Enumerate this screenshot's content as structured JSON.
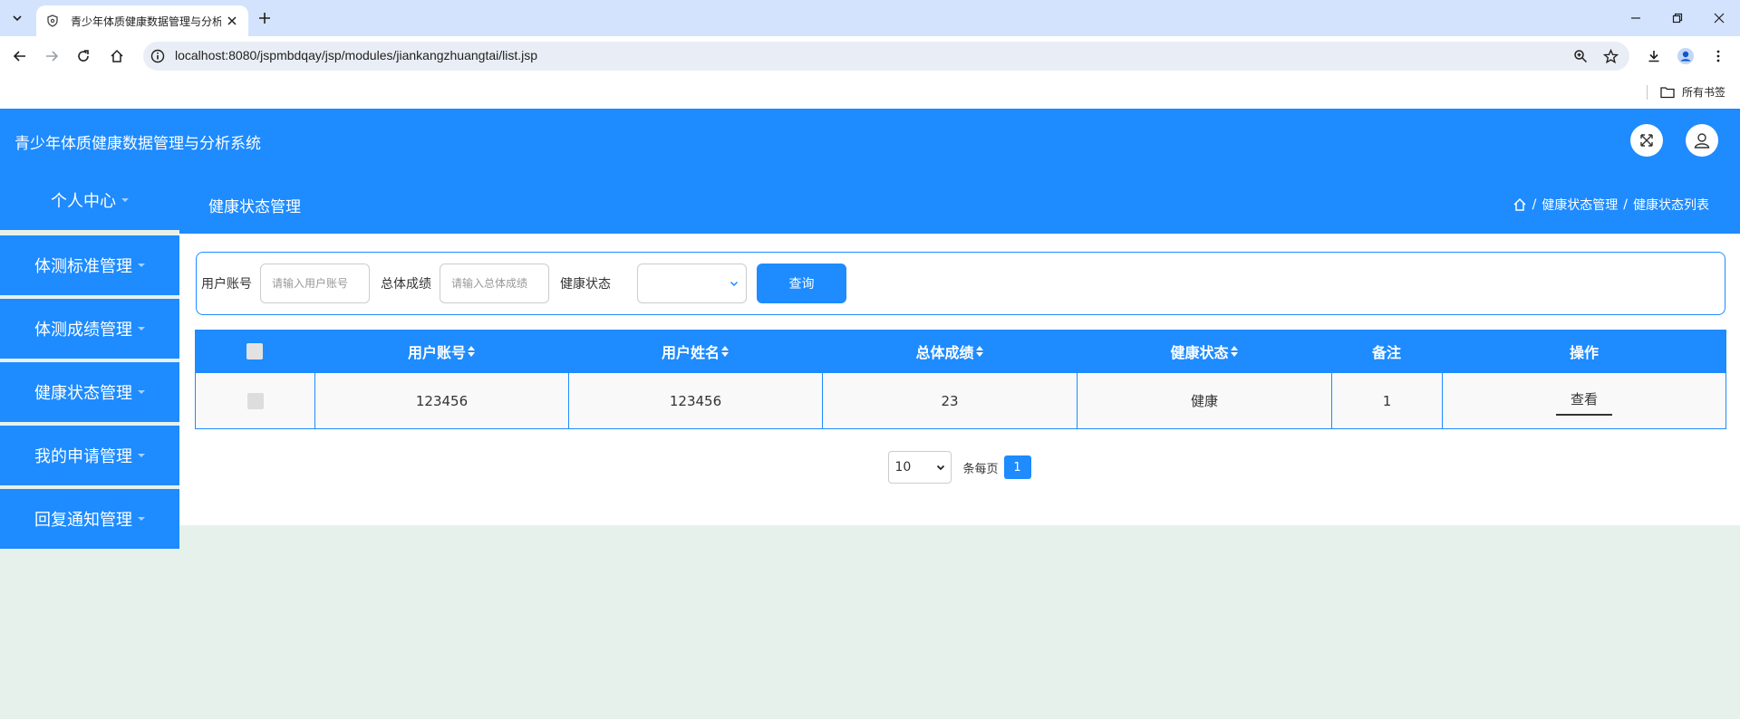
{
  "browser": {
    "tab_title": "青少年体质健康数据管理与分析",
    "url": "localhost:8080/jspmbdqay/jsp/modules/jiankangzhuangtai/list.jsp",
    "bookmarks_label": "所有书签"
  },
  "app": {
    "title": "青少年体质健康数据管理与分析系统"
  },
  "sidebar": {
    "items": [
      {
        "label": "个人中心"
      },
      {
        "label": "体测标准管理"
      },
      {
        "label": "体测成绩管理"
      },
      {
        "label": "健康状态管理"
      },
      {
        "label": "我的申请管理"
      },
      {
        "label": "回复通知管理"
      }
    ]
  },
  "page": {
    "title": "健康状态管理",
    "breadcrumb": [
      "健康状态管理",
      "健康状态列表"
    ],
    "breadcrumb_sep": "/"
  },
  "search": {
    "account_label": "用户账号",
    "account_placeholder": "请输入用户账号",
    "score_label": "总体成绩",
    "score_placeholder": "请输入总体成绩",
    "status_label": "健康状态",
    "status_value": "",
    "query_button": "查询"
  },
  "table": {
    "headers": [
      "用户账号",
      "用户姓名",
      "总体成绩",
      "健康状态",
      "备注",
      "操作"
    ],
    "rows": [
      {
        "account": "123456",
        "name": "123456",
        "score": "23",
        "status": "健康",
        "note": "1",
        "action": "查看"
      }
    ]
  },
  "pagination": {
    "page_size": "10",
    "per_page_label": "条每页",
    "current_page": "1"
  },
  "colors": {
    "primary": "#1e8bff",
    "background": "#e6f1ec"
  }
}
